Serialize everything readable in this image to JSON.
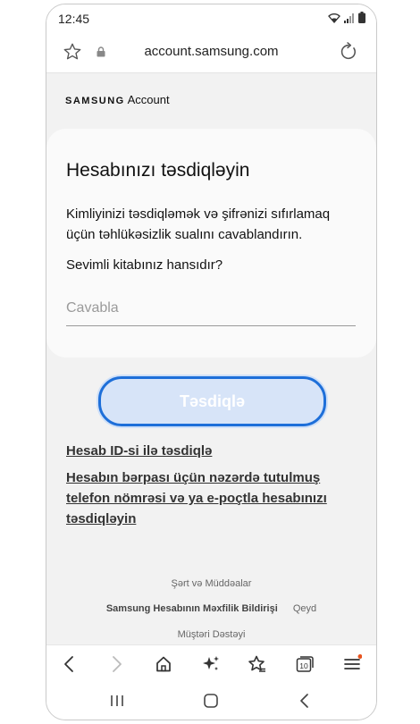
{
  "status": {
    "time": "12:45"
  },
  "browser": {
    "url": "account.samsung.com"
  },
  "brand": {
    "name": "SAMSUNG",
    "product": "Account"
  },
  "card": {
    "title": "Hesabınızı təsdiqləyin",
    "description": "Kimliyinizi təsdiqləmək və şifrənizi sıfırlamaq üçün təhlükəsizlik sualını cavablandırın.",
    "question": "Sevimli kitabınız hansıdır?",
    "answer_placeholder": "Cavabla",
    "answer_value": ""
  },
  "confirm_button": {
    "label": "Təsdiqlə",
    "enabled": false
  },
  "links": {
    "verify_by_id": "Hesab ID-si ilə təsdiqlə",
    "verify_by_recovery": "Hesabın bərpası üçün nəzərdə tutulmuş telefon nömrəsi və ya e-poçtla hesabınızı təsdiqləyin"
  },
  "footer": {
    "terms": "Şərt və Müddəalar",
    "privacy": "Samsung Hesabının Məxfilik Bildirişi",
    "note": "Qeyd",
    "support": "Müştəri Dəstəyi"
  },
  "browser_toolbar": {
    "tabs_count": "10",
    "icons": [
      "back-icon",
      "forward-icon",
      "home-icon",
      "sparkle-icon",
      "bookmarks-icon",
      "tabs-icon",
      "menu-icon"
    ]
  },
  "colors": {
    "accent": "#1e6fd9",
    "button_fill": "#d7e4f8",
    "notification_dot": "#e8541f"
  }
}
